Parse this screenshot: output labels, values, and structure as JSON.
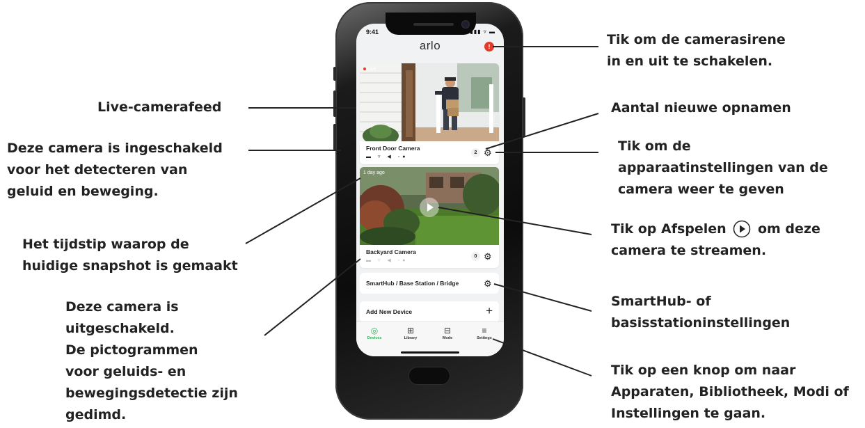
{
  "phone": {
    "status_time": "9:41",
    "status_icons": "▮▮▮ ▿ ▬",
    "app_title": "arlo",
    "siren_glyph": "!",
    "cameras": [
      {
        "name": "Front Door Camera",
        "tag": "Live",
        "count": "2",
        "icons": "▬ ▿ ◀ ◦●",
        "icons_dim": false
      },
      {
        "name": "Backyard Camera",
        "tag": "1 day ago",
        "count": "0",
        "icons": "▬ ▿ ◀ ◦●",
        "icons_dim": true
      }
    ],
    "hub_label": "SmartHub / Base Station / Bridge",
    "add_label": "Add New Device",
    "add_glyph": "+",
    "gear_glyph": "⚙",
    "tabs": [
      {
        "label": "Devices",
        "icon": "◎",
        "active": true
      },
      {
        "label": "Library",
        "icon": "⊞",
        "active": false
      },
      {
        "label": "Mode",
        "icon": "⊟",
        "active": false
      },
      {
        "label": "Settings",
        "icon": "≡",
        "active": false
      }
    ]
  },
  "annotations": {
    "live_feed": "Live-camerafeed",
    "enabled_l1": "Deze camera is ingeschakeld",
    "enabled_l2": "voor het detecteren van",
    "enabled_l3": "geluid en beweging.",
    "snapshot_l1": "Het tijdstip waarop de",
    "snapshot_l2": "huidige snapshot is gemaakt",
    "disabled_l1": "Deze camera is",
    "disabled_l2": "uitgeschakeld.",
    "disabled_l3": "De pictogrammen",
    "disabled_l4": "voor geluids- en",
    "disabled_l5": "bewegingsdetectie zijn",
    "disabled_l6": "gedimd.",
    "siren_l1": "Tik om de camerasirene",
    "siren_l2": "in en uit te schakelen.",
    "new_recordings": "Aantal nieuwe opnamen",
    "device_settings_l1": "Tik om de",
    "device_settings_l2": "apparaatinstellingen van de",
    "device_settings_l3": "camera weer te geven",
    "play_l1_a": "Tik op Afspelen",
    "play_l1_b": "om deze",
    "play_l2": "camera te streamen.",
    "hub_l1": "SmartHub- of",
    "hub_l2": "basisstationinstellingen",
    "nav_l1": "Tik op een knop om naar",
    "nav_l2": "Apparaten, Bibliotheek, Modi of",
    "nav_l3": "Instellingen te gaan."
  },
  "colors": {
    "accent_green": "#2fae56",
    "siren_red": "#e23a2b"
  }
}
